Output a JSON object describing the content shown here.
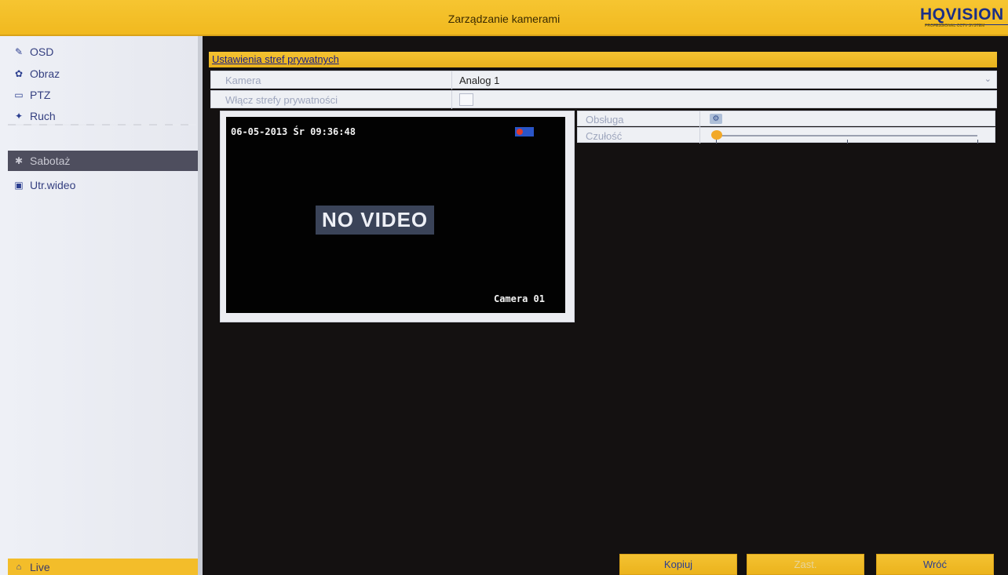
{
  "window": {
    "title": "Zarządzanie kamerami",
    "brand": "HQVISION",
    "brand_tagline": "PROFESSIONAL CCTV SYSTEM"
  },
  "sidebar": {
    "items": [
      {
        "label": "OSD",
        "icon": "osd-icon"
      },
      {
        "label": "Obraz",
        "icon": "image-icon"
      },
      {
        "label": "PTZ",
        "icon": "ptz-icon"
      },
      {
        "label": "Ruch",
        "icon": "motion-icon"
      },
      {
        "label": "Sabotaż",
        "icon": "tamper-icon",
        "selected": true
      },
      {
        "label": "Utr.wideo",
        "icon": "video-loss-icon"
      }
    ],
    "live_label": "Live"
  },
  "section": {
    "title": "Ustawienia stref prywatnych"
  },
  "form": {
    "camera_label": "Kamera",
    "camera_value": "Analog 1",
    "enable_label": "Włącz strefy prywatności",
    "enable_checked": false
  },
  "preview": {
    "timestamp": "06-05-2013 Śr 09:36:48",
    "status_text": "NO VIDEO",
    "camera_name": "Camera 01"
  },
  "properties": {
    "handling_label": "Obsługa",
    "sensitivity_label": "Czułość",
    "sensitivity_value": 0
  },
  "buttons": {
    "copy": "Kopiuj",
    "apply": "Zast.",
    "back": "Wróć"
  },
  "colors": {
    "accent": "#f3bd2a",
    "text_blue": "#2c3f90",
    "background": "#141111"
  }
}
